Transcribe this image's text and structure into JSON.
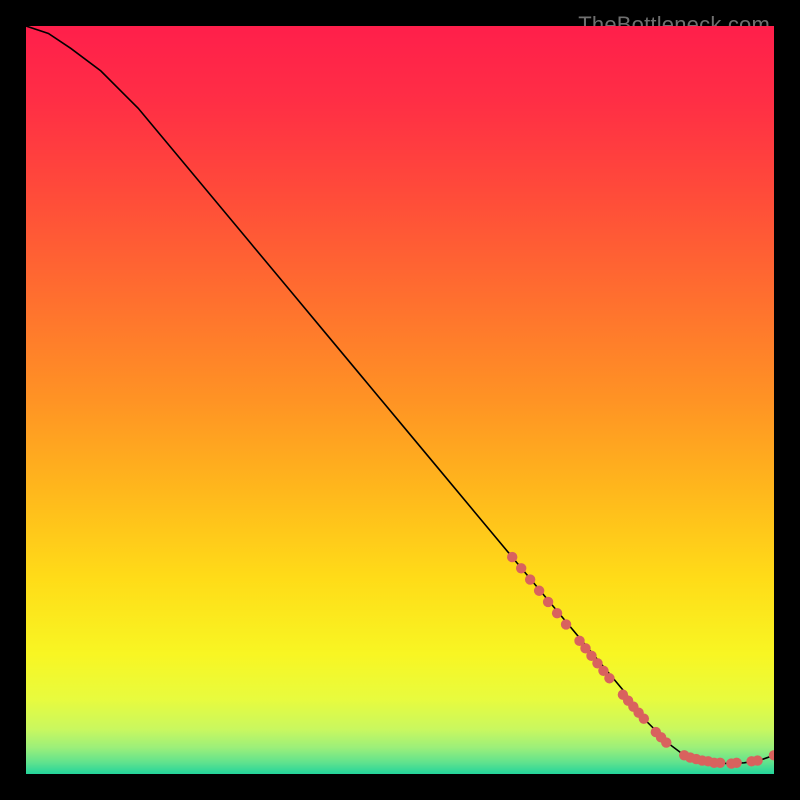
{
  "watermark": "TheBottleneck.com",
  "chart_data": {
    "type": "line",
    "title": "",
    "xlabel": "",
    "ylabel": "",
    "xlim": [
      0,
      100
    ],
    "ylim": [
      0,
      100
    ],
    "grid": false,
    "series": [
      {
        "name": "bottleneck-curve",
        "x": [
          0,
          3,
          6,
          10,
          15,
          20,
          25,
          30,
          35,
          40,
          45,
          50,
          55,
          60,
          65,
          70,
          75,
          80,
          83,
          86,
          88,
          90,
          92,
          94,
          96,
          98,
          100
        ],
        "y": [
          100,
          99,
          97,
          94,
          89,
          83,
          77,
          71,
          65,
          59,
          53,
          47,
          41,
          35,
          29,
          23,
          17,
          11,
          7,
          4,
          2.5,
          1.8,
          1.5,
          1.4,
          1.5,
          1.8,
          2.5
        ]
      }
    ],
    "marker_clusters": [
      {
        "name": "cluster-a",
        "points": [
          {
            "x": 65.0,
            "y": 29.0
          },
          {
            "x": 66.2,
            "y": 27.5
          },
          {
            "x": 67.4,
            "y": 26.0
          },
          {
            "x": 68.6,
            "y": 24.5
          },
          {
            "x": 69.8,
            "y": 23.0
          },
          {
            "x": 71.0,
            "y": 21.5
          },
          {
            "x": 72.2,
            "y": 20.0
          }
        ]
      },
      {
        "name": "cluster-b",
        "points": [
          {
            "x": 74.0,
            "y": 17.8
          },
          {
            "x": 74.8,
            "y": 16.8
          },
          {
            "x": 75.6,
            "y": 15.8
          },
          {
            "x": 76.4,
            "y": 14.8
          },
          {
            "x": 77.2,
            "y": 13.8
          },
          {
            "x": 78.0,
            "y": 12.8
          }
        ]
      },
      {
        "name": "cluster-c",
        "points": [
          {
            "x": 79.8,
            "y": 10.6
          },
          {
            "x": 80.5,
            "y": 9.8
          },
          {
            "x": 81.2,
            "y": 9.0
          },
          {
            "x": 81.9,
            "y": 8.2
          },
          {
            "x": 82.6,
            "y": 7.4
          }
        ]
      },
      {
        "name": "cluster-d",
        "points": [
          {
            "x": 84.2,
            "y": 5.6
          },
          {
            "x": 84.9,
            "y": 4.9
          },
          {
            "x": 85.6,
            "y": 4.2
          }
        ]
      },
      {
        "name": "cluster-flat",
        "points": [
          {
            "x": 88.0,
            "y": 2.5
          },
          {
            "x": 88.8,
            "y": 2.2
          },
          {
            "x": 89.6,
            "y": 2.0
          },
          {
            "x": 90.4,
            "y": 1.8
          },
          {
            "x": 91.2,
            "y": 1.7
          },
          {
            "x": 92.0,
            "y": 1.5
          },
          {
            "x": 92.8,
            "y": 1.5
          }
        ]
      },
      {
        "name": "cluster-e",
        "points": [
          {
            "x": 94.3,
            "y": 1.4
          },
          {
            "x": 95.0,
            "y": 1.5
          }
        ]
      },
      {
        "name": "cluster-f",
        "points": [
          {
            "x": 97.0,
            "y": 1.7
          },
          {
            "x": 97.8,
            "y": 1.8
          }
        ]
      },
      {
        "name": "cluster-g",
        "points": [
          {
            "x": 100.0,
            "y": 2.5
          }
        ]
      }
    ],
    "background_gradient": {
      "stops": [
        {
          "offset": 0.0,
          "color": "#ff1f4b"
        },
        {
          "offset": 0.1,
          "color": "#ff2e45"
        },
        {
          "offset": 0.22,
          "color": "#ff4a3a"
        },
        {
          "offset": 0.36,
          "color": "#ff6e2f"
        },
        {
          "offset": 0.5,
          "color": "#ff9324"
        },
        {
          "offset": 0.62,
          "color": "#ffb71c"
        },
        {
          "offset": 0.74,
          "color": "#ffdc18"
        },
        {
          "offset": 0.84,
          "color": "#f8f623"
        },
        {
          "offset": 0.9,
          "color": "#e8fb3e"
        },
        {
          "offset": 0.94,
          "color": "#c9f85f"
        },
        {
          "offset": 0.965,
          "color": "#9bef7a"
        },
        {
          "offset": 0.985,
          "color": "#5fe28e"
        },
        {
          "offset": 1.0,
          "color": "#23d49b"
        }
      ]
    },
    "marker_color": "#d9625e",
    "curve_color": "#000000"
  }
}
